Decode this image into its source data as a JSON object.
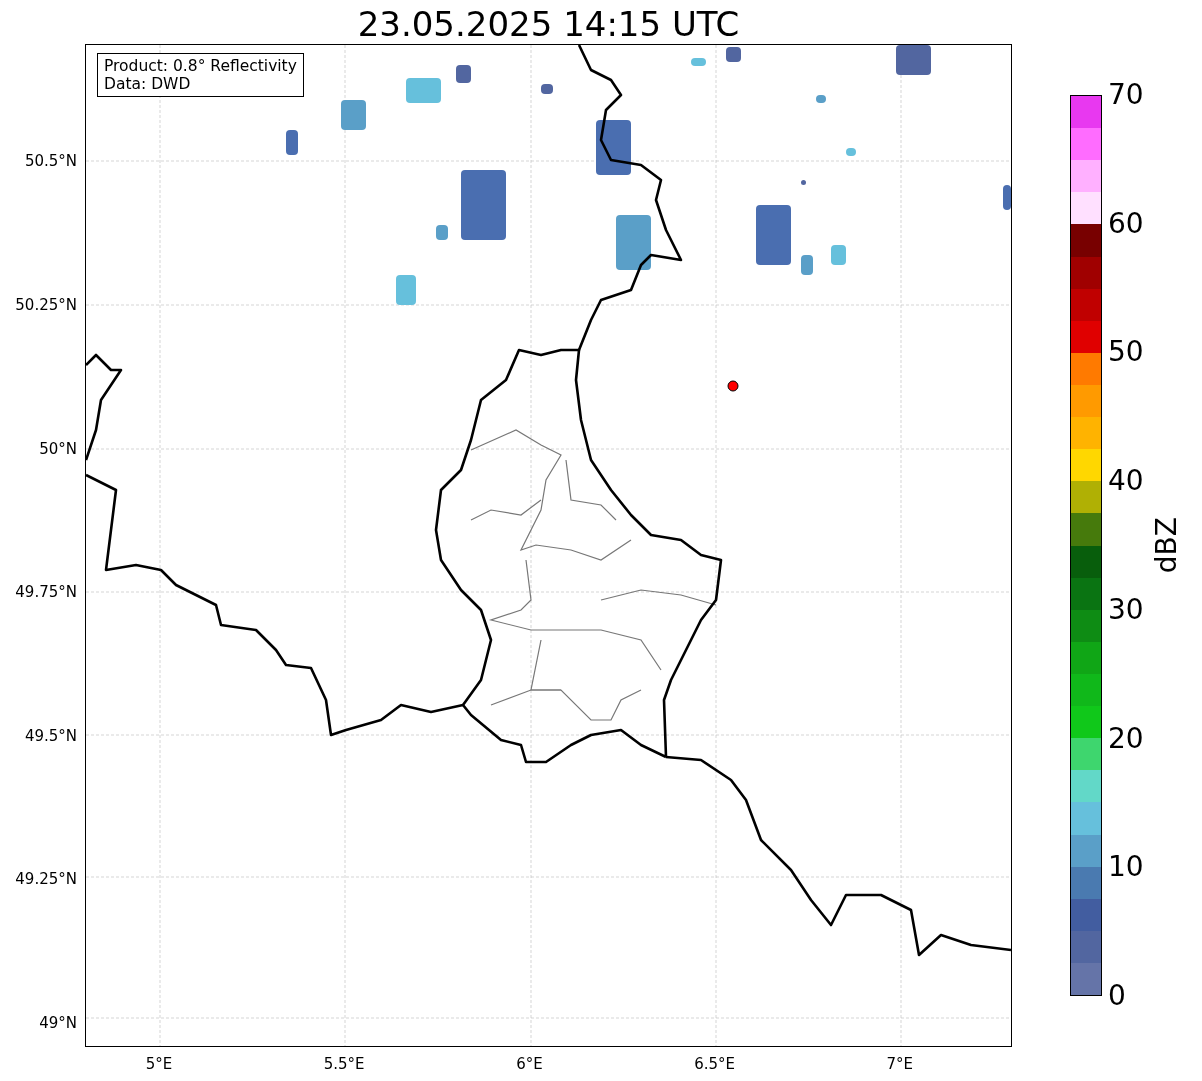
{
  "title": "23.05.2025 14:15 UTC",
  "annotation": [
    "Product: 0.8° Reflectivity",
    "Data: DWD"
  ],
  "y_ticks": [
    "50.5°N",
    "50.25°N",
    "50°N",
    "49.75°N",
    "49.5°N",
    "49.25°N",
    "49°N"
  ],
  "x_ticks": [
    "5°E",
    "5.5°E",
    "6°E",
    "6.5°E",
    "7°E"
  ],
  "colorbar": {
    "label": "dBZ",
    "ticks": [
      "70",
      "60",
      "50",
      "40",
      "30",
      "20",
      "10",
      "0"
    ],
    "segments": [
      {
        "color": "#e838f0"
      },
      {
        "color": "#ff6cff"
      },
      {
        "color": "#ffb0ff"
      },
      {
        "color": "#ffe0ff"
      },
      {
        "color": "#780000"
      },
      {
        "color": "#a00000"
      },
      {
        "color": "#c00000"
      },
      {
        "color": "#e00000"
      },
      {
        "color": "#ff7a00"
      },
      {
        "color": "#ff9a00"
      },
      {
        "color": "#ffb300"
      },
      {
        "color": "#ffd700"
      },
      {
        "color": "#b0b004"
      },
      {
        "color": "#467a0c"
      },
      {
        "color": "#085e0c"
      },
      {
        "color": "#0a7412"
      },
      {
        "color": "#0e8c14"
      },
      {
        "color": "#10a616"
      },
      {
        "color": "#10b81a"
      },
      {
        "color": "#10c81a"
      },
      {
        "color": "#3ed66e"
      },
      {
        "color": "#62d8c8"
      },
      {
        "color": "#66c0dc"
      },
      {
        "color": "#5a9fc8"
      },
      {
        "color": "#4a7ab0"
      },
      {
        "color": "#425da0"
      },
      {
        "color": "#5266a0"
      },
      {
        "color": "#6574a8"
      }
    ]
  }
}
